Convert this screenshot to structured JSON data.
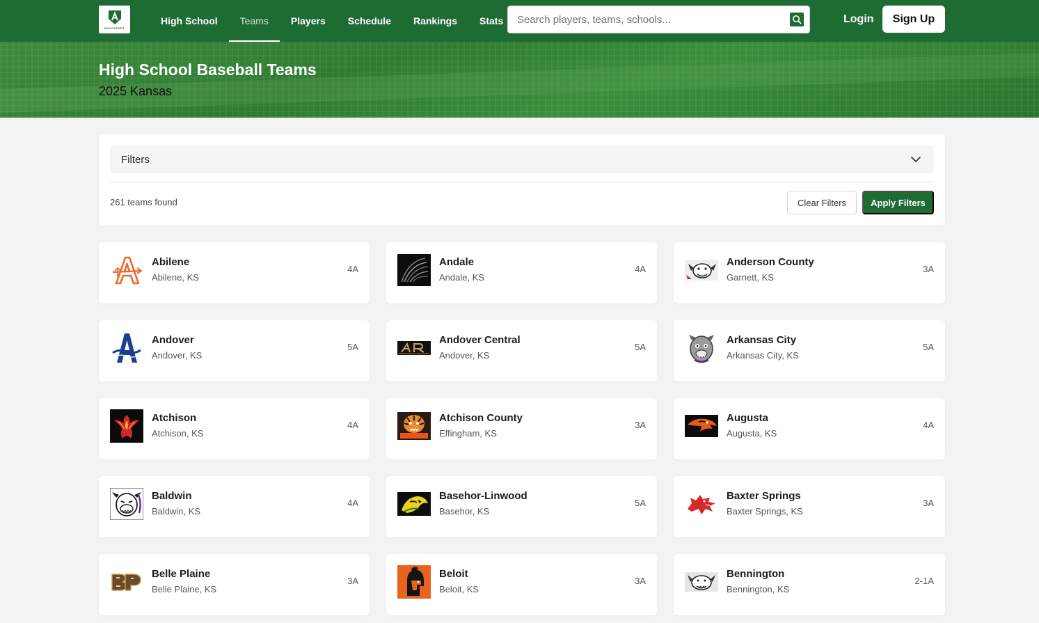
{
  "brand": {
    "logo_text": "AMYOSPORT"
  },
  "nav": {
    "links": [
      {
        "label": "High School",
        "active": false
      },
      {
        "label": "Teams",
        "active": true
      },
      {
        "label": "Players",
        "active": false
      },
      {
        "label": "Schedule",
        "active": false
      },
      {
        "label": "Rankings",
        "active": false
      },
      {
        "label": "Stats",
        "active": false
      }
    ],
    "search_placeholder": "Search players, teams, schools...",
    "search_icon": "search-icon",
    "login_label": "Login",
    "signup_label": "Sign Up"
  },
  "hero": {
    "title": "High School Baseball Teams",
    "subtitle": "2025 Kansas"
  },
  "filters": {
    "label": "Filters",
    "toggle_icon": "chevron-down-icon",
    "count_text": "261 teams found",
    "clear_label": "Clear Filters",
    "apply_label": "Apply Filters"
  },
  "colors": {
    "brand_green": "#1e6b33",
    "hero_green": "#2f7b31",
    "page_bg": "#f3f3f3"
  },
  "teams": [
    {
      "name": "Abilene",
      "location": "Abilene, KS",
      "class": "4A",
      "logo_icon": "abilene-logo-icon"
    },
    {
      "name": "Andale",
      "location": "Andale, KS",
      "class": "4A",
      "logo_icon": "andale-logo-icon"
    },
    {
      "name": "Anderson County",
      "location": "Garnett, KS",
      "class": "3A",
      "logo_icon": "anderson-county-logo-icon"
    },
    {
      "name": "Andover",
      "location": "Andover, KS",
      "class": "5A",
      "logo_icon": "andover-logo-icon"
    },
    {
      "name": "Andover Central",
      "location": "Andover, KS",
      "class": "5A",
      "logo_icon": "andover-central-logo-icon"
    },
    {
      "name": "Arkansas City",
      "location": "Arkansas City, KS",
      "class": "5A",
      "logo_icon": "arkansas-city-logo-icon"
    },
    {
      "name": "Atchison",
      "location": "Atchison, KS",
      "class": "4A",
      "logo_icon": "atchison-logo-icon"
    },
    {
      "name": "Atchison County",
      "location": "Effingham, KS",
      "class": "3A",
      "logo_icon": "atchison-county-logo-icon"
    },
    {
      "name": "Augusta",
      "location": "Augusta, KS",
      "class": "4A",
      "logo_icon": "augusta-logo-icon"
    },
    {
      "name": "Baldwin",
      "location": "Baldwin, KS",
      "class": "4A",
      "logo_icon": "baldwin-logo-icon"
    },
    {
      "name": "Basehor-Linwood",
      "location": "Basehor, KS",
      "class": "5A",
      "logo_icon": "basehor-linwood-logo-icon"
    },
    {
      "name": "Baxter Springs",
      "location": "Baxter Springs, KS",
      "class": "3A",
      "logo_icon": "baxter-springs-logo-icon"
    },
    {
      "name": "Belle Plaine",
      "location": "Belle Plaine, KS",
      "class": "3A",
      "logo_icon": "belle-plaine-logo-icon"
    },
    {
      "name": "Beloit",
      "location": "Beloit, KS",
      "class": "3A",
      "logo_icon": "beloit-logo-icon"
    },
    {
      "name": "Bennington",
      "location": "Bennington, KS",
      "class": "2-1A",
      "logo_icon": "bennington-logo-icon"
    }
  ]
}
